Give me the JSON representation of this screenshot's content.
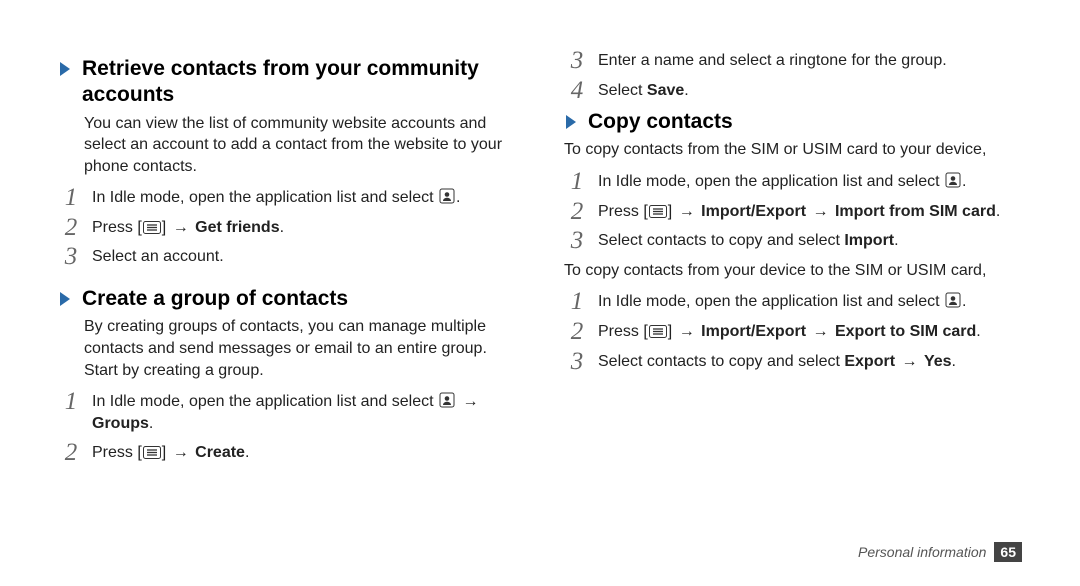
{
  "left": {
    "s1": {
      "title": "Retrieve contacts from your community accounts",
      "body": "You can view the list of community website accounts and select an account to add a contact from the website to your phone contacts.",
      "steps": {
        "n1": "1",
        "t1a": "In Idle mode, open the application list and select ",
        "t1b": ".",
        "n2": "2",
        "t2a": "Press [",
        "t2b": "] ",
        "t2c": "Get friends",
        "t2d": ".",
        "n3": "3",
        "t3": "Select an account."
      }
    },
    "s2": {
      "title": "Create a group of contacts",
      "body": "By creating groups of contacts, you can manage multiple contacts and send messages or email to an entire group. Start by creating a group.",
      "steps": {
        "n1": "1",
        "t1a": "In Idle mode, open the application list and select ",
        "t1b": " ",
        "t1c": "Groups",
        "t1d": ".",
        "n2": "2",
        "t2a": "Press [",
        "t2b": "] ",
        "t2c": "Create",
        "t2d": "."
      }
    }
  },
  "right": {
    "cont": {
      "n3": "3",
      "t3": "Enter a name and select a ringtone for the group.",
      "n4": "4",
      "t4a": "Select ",
      "t4b": "Save",
      "t4c": "."
    },
    "s1": {
      "title": "Copy contacts",
      "body1": "To copy contacts from the SIM or USIM card to your device,",
      "stepsA": {
        "n1": "1",
        "t1a": "In Idle mode, open the application list and select ",
        "t1b": ".",
        "n2": "2",
        "t2a": "Press [",
        "t2b": "] ",
        "t2c": "Import/Export",
        "t2d": " ",
        "t2e": "Import from SIM card",
        "t2f": ".",
        "n3": "3",
        "t3a": "Select contacts to copy and select ",
        "t3b": "Import",
        "t3c": "."
      },
      "body2": "To copy contacts from your device to the SIM or USIM card,",
      "stepsB": {
        "n1": "1",
        "t1a": "In Idle mode, open the application list and select ",
        "t1b": ".",
        "n2": "2",
        "t2a": "Press [",
        "t2b": "] ",
        "t2c": "Import/Export",
        "t2d": " ",
        "t2e": "Export to SIM card",
        "t2f": ".",
        "n3": "3",
        "t3a": "Select contacts to copy and select ",
        "t3b": "Export",
        "t3c": " ",
        "t3d": "Yes",
        "t3e": "."
      }
    }
  },
  "arrow": "→",
  "footer": {
    "label": "Personal information",
    "page": "65"
  }
}
